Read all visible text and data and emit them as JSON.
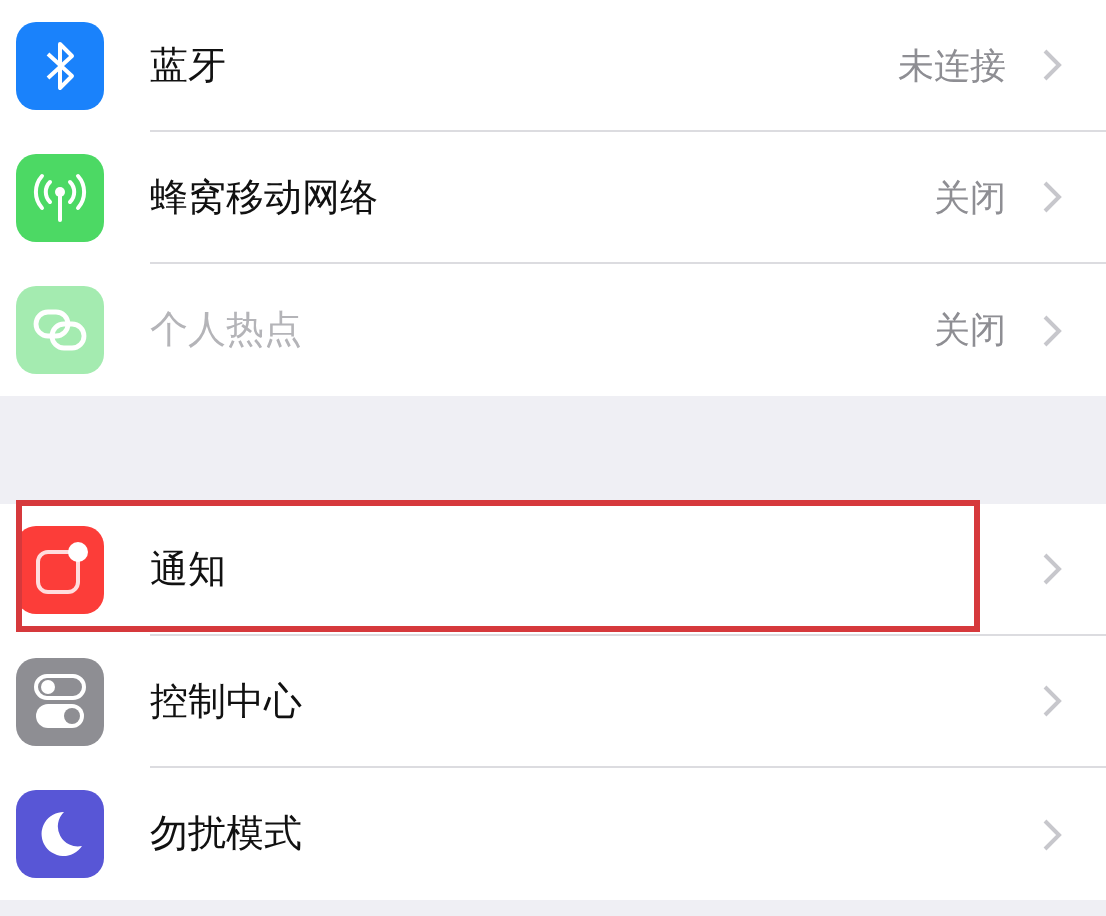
{
  "groups": [
    {
      "rows": [
        {
          "kind": "bluetooth",
          "label": "蓝牙",
          "value": "未连接",
          "disabled": false,
          "highlighted": false
        },
        {
          "kind": "cellular",
          "label": "蜂窝移动网络",
          "value": "关闭",
          "disabled": false,
          "highlighted": false
        },
        {
          "kind": "hotspot",
          "label": "个人热点",
          "value": "关闭",
          "disabled": true,
          "highlighted": false
        }
      ]
    },
    {
      "rows": [
        {
          "kind": "notifications",
          "label": "通知",
          "disabled": false,
          "highlighted": true
        },
        {
          "kind": "control",
          "label": "控制中心",
          "disabled": false,
          "highlighted": false
        },
        {
          "kind": "dnd",
          "label": "勿扰模式",
          "disabled": false,
          "highlighted": false
        }
      ]
    }
  ]
}
